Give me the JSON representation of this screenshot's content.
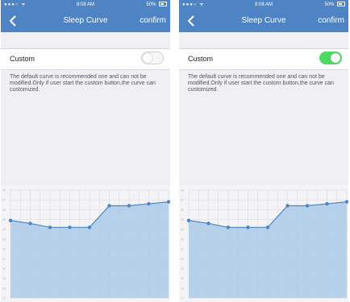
{
  "screens": [
    {
      "status": {
        "signal": "●●●○ ᯤ",
        "time": "8:08 AM",
        "battery": "50%"
      },
      "nav": {
        "title": "Sleep Curve",
        "confirm": "confirm"
      },
      "custom": {
        "label": "Custom",
        "enabled": false
      },
      "description": "The default curve is recommended one and can not be modified.Only if user start the custom button,the curve can customized."
    },
    {
      "status": {
        "signal": "●●●○ ᯤ",
        "time": "8:08 AM",
        "battery": "50%"
      },
      "nav": {
        "title": "Sleep Curve",
        "confirm": "confirm"
      },
      "custom": {
        "label": "Custom",
        "enabled": true
      },
      "description": "The default curve is recommended one and can not be modified.Only if user start the custom button,the curve can customized."
    }
  ],
  "colors": {
    "nav": "#4f84c4",
    "toggle_on": "#4cd964",
    "line": "#4a86c6",
    "area": "#a9c8e6"
  },
  "chart_data": {
    "type": "area",
    "x": [
      0,
      1,
      2,
      3,
      4,
      5,
      6,
      7,
      8
    ],
    "values": [
      24.9,
      24.6,
      24.2,
      24.2,
      24.2,
      26.4,
      26.4,
      26.6,
      26.8
    ],
    "ylim": [
      17,
      28
    ],
    "grid": true,
    "marker": "circle"
  }
}
